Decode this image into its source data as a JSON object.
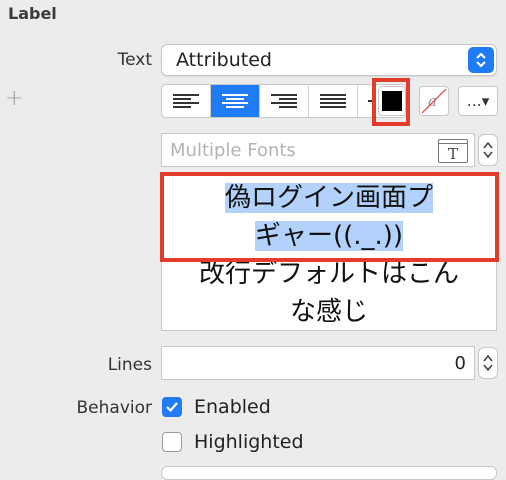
{
  "section": {
    "title": "Label"
  },
  "text_row": {
    "label": "Text",
    "popup_value": "Attributed"
  },
  "alignment": {
    "buttons": [
      {
        "name": "align-left-icon",
        "selected": false
      },
      {
        "name": "align-center-icon",
        "selected": true
      },
      {
        "name": "align-right-icon",
        "selected": false
      },
      {
        "name": "align-justify-icon",
        "selected": false
      },
      {
        "name": "align-natural-icon",
        "selected": false
      }
    ]
  },
  "text_color": "#000000",
  "background_glyph": "a",
  "more_button": {
    "label": "…▾"
  },
  "font": {
    "placeholder": "Multiple Fonts",
    "icon_letter": "T"
  },
  "attributed_text": {
    "selected_line1": "偽ログイン画面プ",
    "selected_line2": "ギャー((._.))",
    "rest_line1": "改行デフォルトはこん",
    "rest_line2": "な感じ"
  },
  "lines": {
    "label": "Lines",
    "value": "0"
  },
  "behavior": {
    "label": "Behavior",
    "enabled": {
      "label": "Enabled",
      "checked": true
    },
    "highlighted": {
      "label": "Highlighted",
      "checked": false
    }
  },
  "colors": {
    "accent": "#1f7cf6",
    "annotation": "#e33b2e",
    "selection": "#b3d2fb"
  }
}
